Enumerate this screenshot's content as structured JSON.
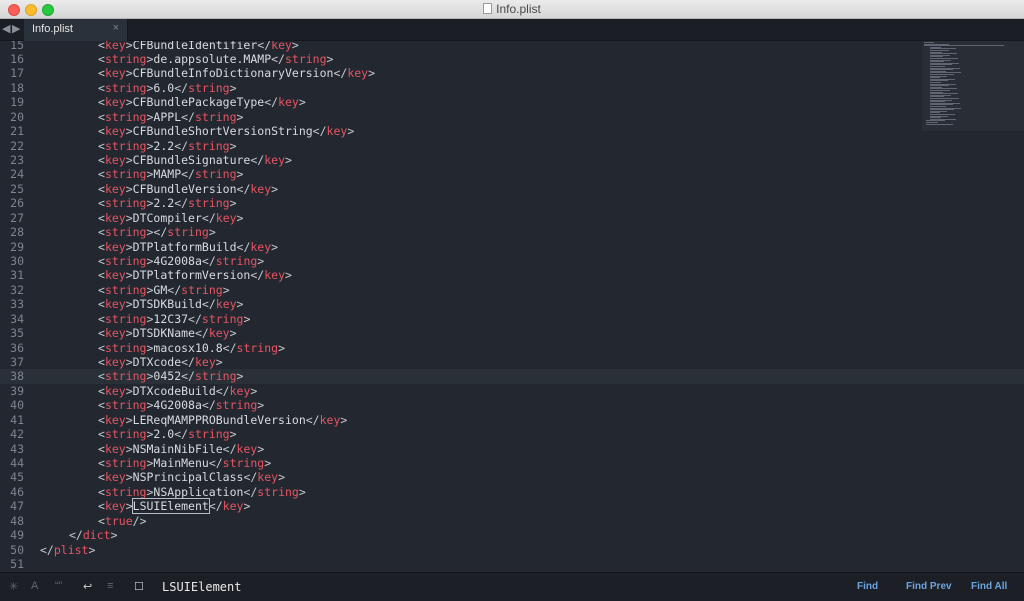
{
  "window": {
    "title": "Info.plist"
  },
  "tabs": [
    {
      "label": "Info.plist",
      "close": "×"
    }
  ],
  "nav": {
    "back": "◀",
    "forward": "▶"
  },
  "editor": {
    "current_line": 38,
    "lines": [
      {
        "n": "15",
        "indent": 2,
        "parts": [
          [
            "br",
            "<"
          ],
          [
            "tag",
            "key"
          ],
          [
            "br",
            ">"
          ],
          [
            "t",
            "CFBundleIdentifier"
          ],
          [
            "br",
            "</"
          ],
          [
            "tag",
            "key"
          ],
          [
            "br",
            ">"
          ]
        ]
      },
      {
        "n": "16",
        "indent": 2,
        "parts": [
          [
            "br",
            "<"
          ],
          [
            "tag",
            "string"
          ],
          [
            "br",
            ">"
          ],
          [
            "t",
            "de.appsolute.MAMP"
          ],
          [
            "br",
            "</"
          ],
          [
            "tag",
            "string"
          ],
          [
            "br",
            ">"
          ]
        ]
      },
      {
        "n": "17",
        "indent": 2,
        "parts": [
          [
            "br",
            "<"
          ],
          [
            "tag",
            "key"
          ],
          [
            "br",
            ">"
          ],
          [
            "t",
            "CFBundleInfoDictionaryVersion"
          ],
          [
            "br",
            "</"
          ],
          [
            "tag",
            "key"
          ],
          [
            "br",
            ">"
          ]
        ]
      },
      {
        "n": "18",
        "indent": 2,
        "parts": [
          [
            "br",
            "<"
          ],
          [
            "tag",
            "string"
          ],
          [
            "br",
            ">"
          ],
          [
            "t",
            "6.0"
          ],
          [
            "br",
            "</"
          ],
          [
            "tag",
            "string"
          ],
          [
            "br",
            ">"
          ]
        ]
      },
      {
        "n": "19",
        "indent": 2,
        "parts": [
          [
            "br",
            "<"
          ],
          [
            "tag",
            "key"
          ],
          [
            "br",
            ">"
          ],
          [
            "t",
            "CFBundlePackageType"
          ],
          [
            "br",
            "</"
          ],
          [
            "tag",
            "key"
          ],
          [
            "br",
            ">"
          ]
        ]
      },
      {
        "n": "20",
        "indent": 2,
        "parts": [
          [
            "br",
            "<"
          ],
          [
            "tag",
            "string"
          ],
          [
            "br",
            ">"
          ],
          [
            "t",
            "APPL"
          ],
          [
            "br",
            "</"
          ],
          [
            "tag",
            "string"
          ],
          [
            "br",
            ">"
          ]
        ]
      },
      {
        "n": "21",
        "indent": 2,
        "parts": [
          [
            "br",
            "<"
          ],
          [
            "tag",
            "key"
          ],
          [
            "br",
            ">"
          ],
          [
            "t",
            "CFBundleShortVersionString"
          ],
          [
            "br",
            "</"
          ],
          [
            "tag",
            "key"
          ],
          [
            "br",
            ">"
          ]
        ]
      },
      {
        "n": "22",
        "indent": 2,
        "parts": [
          [
            "br",
            "<"
          ],
          [
            "tag",
            "string"
          ],
          [
            "br",
            ">"
          ],
          [
            "t",
            "2.2"
          ],
          [
            "br",
            "</"
          ],
          [
            "tag",
            "string"
          ],
          [
            "br",
            ">"
          ]
        ]
      },
      {
        "n": "23",
        "indent": 2,
        "parts": [
          [
            "br",
            "<"
          ],
          [
            "tag",
            "key"
          ],
          [
            "br",
            ">"
          ],
          [
            "t",
            "CFBundleSignature"
          ],
          [
            "br",
            "</"
          ],
          [
            "tag",
            "key"
          ],
          [
            "br",
            ">"
          ]
        ]
      },
      {
        "n": "24",
        "indent": 2,
        "parts": [
          [
            "br",
            "<"
          ],
          [
            "tag",
            "string"
          ],
          [
            "br",
            ">"
          ],
          [
            "t",
            "MAMP"
          ],
          [
            "br",
            "</"
          ],
          [
            "tag",
            "string"
          ],
          [
            "br",
            ">"
          ]
        ]
      },
      {
        "n": "25",
        "indent": 2,
        "parts": [
          [
            "br",
            "<"
          ],
          [
            "tag",
            "key"
          ],
          [
            "br",
            ">"
          ],
          [
            "t",
            "CFBundleVersion"
          ],
          [
            "br",
            "</"
          ],
          [
            "tag",
            "key"
          ],
          [
            "br",
            ">"
          ]
        ]
      },
      {
        "n": "26",
        "indent": 2,
        "parts": [
          [
            "br",
            "<"
          ],
          [
            "tag",
            "string"
          ],
          [
            "br",
            ">"
          ],
          [
            "t",
            "2.2"
          ],
          [
            "br",
            "</"
          ],
          [
            "tag",
            "string"
          ],
          [
            "br",
            ">"
          ]
        ]
      },
      {
        "n": "27",
        "indent": 2,
        "parts": [
          [
            "br",
            "<"
          ],
          [
            "tag",
            "key"
          ],
          [
            "br",
            ">"
          ],
          [
            "t",
            "DTCompiler"
          ],
          [
            "br",
            "</"
          ],
          [
            "tag",
            "key"
          ],
          [
            "br",
            ">"
          ]
        ]
      },
      {
        "n": "28",
        "indent": 2,
        "parts": [
          [
            "br",
            "<"
          ],
          [
            "tag",
            "string"
          ],
          [
            "br",
            "></"
          ],
          [
            "tag",
            "string"
          ],
          [
            "br",
            ">"
          ]
        ]
      },
      {
        "n": "29",
        "indent": 2,
        "parts": [
          [
            "br",
            "<"
          ],
          [
            "tag",
            "key"
          ],
          [
            "br",
            ">"
          ],
          [
            "t",
            "DTPlatformBuild"
          ],
          [
            "br",
            "</"
          ],
          [
            "tag",
            "key"
          ],
          [
            "br",
            ">"
          ]
        ]
      },
      {
        "n": "30",
        "indent": 2,
        "parts": [
          [
            "br",
            "<"
          ],
          [
            "tag",
            "string"
          ],
          [
            "br",
            ">"
          ],
          [
            "t",
            "4G2008a"
          ],
          [
            "br",
            "</"
          ],
          [
            "tag",
            "string"
          ],
          [
            "br",
            ">"
          ]
        ]
      },
      {
        "n": "31",
        "indent": 2,
        "parts": [
          [
            "br",
            "<"
          ],
          [
            "tag",
            "key"
          ],
          [
            "br",
            ">"
          ],
          [
            "t",
            "DTPlatformVersion"
          ],
          [
            "br",
            "</"
          ],
          [
            "tag",
            "key"
          ],
          [
            "br",
            ">"
          ]
        ]
      },
      {
        "n": "32",
        "indent": 2,
        "parts": [
          [
            "br",
            "<"
          ],
          [
            "tag",
            "string"
          ],
          [
            "br",
            ">"
          ],
          [
            "t",
            "GM"
          ],
          [
            "br",
            "</"
          ],
          [
            "tag",
            "string"
          ],
          [
            "br",
            ">"
          ]
        ]
      },
      {
        "n": "33",
        "indent": 2,
        "parts": [
          [
            "br",
            "<"
          ],
          [
            "tag",
            "key"
          ],
          [
            "br",
            ">"
          ],
          [
            "t",
            "DTSDKBuild"
          ],
          [
            "br",
            "</"
          ],
          [
            "tag",
            "key"
          ],
          [
            "br",
            ">"
          ]
        ]
      },
      {
        "n": "34",
        "indent": 2,
        "parts": [
          [
            "br",
            "<"
          ],
          [
            "tag",
            "string"
          ],
          [
            "br",
            ">"
          ],
          [
            "t",
            "12C37"
          ],
          [
            "br",
            "</"
          ],
          [
            "tag",
            "string"
          ],
          [
            "br",
            ">"
          ]
        ]
      },
      {
        "n": "35",
        "indent": 2,
        "parts": [
          [
            "br",
            "<"
          ],
          [
            "tag",
            "key"
          ],
          [
            "br",
            ">"
          ],
          [
            "t",
            "DTSDKName"
          ],
          [
            "br",
            "</"
          ],
          [
            "tag",
            "key"
          ],
          [
            "br",
            ">"
          ]
        ]
      },
      {
        "n": "36",
        "indent": 2,
        "parts": [
          [
            "br",
            "<"
          ],
          [
            "tag",
            "string"
          ],
          [
            "br",
            ">"
          ],
          [
            "t",
            "macosx10.8"
          ],
          [
            "br",
            "</"
          ],
          [
            "tag",
            "string"
          ],
          [
            "br",
            ">"
          ]
        ]
      },
      {
        "n": "37",
        "indent": 2,
        "parts": [
          [
            "br",
            "<"
          ],
          [
            "tag",
            "key"
          ],
          [
            "br",
            ">"
          ],
          [
            "t",
            "DTXcode"
          ],
          [
            "br",
            "</"
          ],
          [
            "tag",
            "key"
          ],
          [
            "br",
            ">"
          ]
        ]
      },
      {
        "n": "38",
        "indent": 2,
        "parts": [
          [
            "br",
            "<"
          ],
          [
            "tag",
            "string"
          ],
          [
            "br",
            ">"
          ],
          [
            "t",
            "0452"
          ],
          [
            "br",
            "</"
          ],
          [
            "tag",
            "string"
          ],
          [
            "br",
            ">"
          ]
        ]
      },
      {
        "n": "39",
        "indent": 2,
        "parts": [
          [
            "br",
            "<"
          ],
          [
            "tag",
            "key"
          ],
          [
            "br",
            ">"
          ],
          [
            "t",
            "DTXcodeBuild"
          ],
          [
            "br",
            "</"
          ],
          [
            "tag",
            "key"
          ],
          [
            "br",
            ">"
          ]
        ]
      },
      {
        "n": "40",
        "indent": 2,
        "parts": [
          [
            "br",
            "<"
          ],
          [
            "tag",
            "string"
          ],
          [
            "br",
            ">"
          ],
          [
            "t",
            "4G2008a"
          ],
          [
            "br",
            "</"
          ],
          [
            "tag",
            "string"
          ],
          [
            "br",
            ">"
          ]
        ]
      },
      {
        "n": "41",
        "indent": 2,
        "parts": [
          [
            "br",
            "<"
          ],
          [
            "tag",
            "key"
          ],
          [
            "br",
            ">"
          ],
          [
            "t",
            "LEReqMAMPPROBundleVersion"
          ],
          [
            "br",
            "</"
          ],
          [
            "tag",
            "key"
          ],
          [
            "br",
            ">"
          ]
        ]
      },
      {
        "n": "42",
        "indent": 2,
        "parts": [
          [
            "br",
            "<"
          ],
          [
            "tag",
            "string"
          ],
          [
            "br",
            ">"
          ],
          [
            "t",
            "2.0"
          ],
          [
            "br",
            "</"
          ],
          [
            "tag",
            "string"
          ],
          [
            "br",
            ">"
          ]
        ]
      },
      {
        "n": "43",
        "indent": 2,
        "parts": [
          [
            "br",
            "<"
          ],
          [
            "tag",
            "key"
          ],
          [
            "br",
            ">"
          ],
          [
            "t",
            "NSMainNibFile"
          ],
          [
            "br",
            "</"
          ],
          [
            "tag",
            "key"
          ],
          [
            "br",
            ">"
          ]
        ]
      },
      {
        "n": "44",
        "indent": 2,
        "parts": [
          [
            "br",
            "<"
          ],
          [
            "tag",
            "string"
          ],
          [
            "br",
            ">"
          ],
          [
            "t",
            "MainMenu"
          ],
          [
            "br",
            "</"
          ],
          [
            "tag",
            "string"
          ],
          [
            "br",
            ">"
          ]
        ]
      },
      {
        "n": "45",
        "indent": 2,
        "parts": [
          [
            "br",
            "<"
          ],
          [
            "tag",
            "key"
          ],
          [
            "br",
            ">"
          ],
          [
            "t",
            "NSPrincipalClass"
          ],
          [
            "br",
            "</"
          ],
          [
            "tag",
            "key"
          ],
          [
            "br",
            ">"
          ]
        ]
      },
      {
        "n": "46",
        "indent": 2,
        "parts": [
          [
            "br",
            "<"
          ],
          [
            "tag",
            "string"
          ],
          [
            "br",
            ">"
          ],
          [
            "t",
            "NSApplication"
          ],
          [
            "br",
            "</"
          ],
          [
            "tag",
            "string"
          ],
          [
            "br",
            ">"
          ]
        ]
      },
      {
        "n": "47",
        "indent": 2,
        "parts": [
          [
            "br",
            "<"
          ],
          [
            "tag",
            "key"
          ],
          [
            "br",
            ">"
          ],
          [
            "hl",
            "LSUIElement"
          ],
          [
            "br",
            "</"
          ],
          [
            "tag",
            "key"
          ],
          [
            "br",
            ">"
          ]
        ]
      },
      {
        "n": "48",
        "indent": 2,
        "parts": [
          [
            "br",
            "<"
          ],
          [
            "tag",
            "true"
          ],
          [
            "br",
            "/>"
          ]
        ]
      },
      {
        "n": "49",
        "indent": 1,
        "parts": [
          [
            "br",
            "</"
          ],
          [
            "tag",
            "dict"
          ],
          [
            "br",
            ">"
          ]
        ]
      },
      {
        "n": "50",
        "indent": 0,
        "parts": [
          [
            "br",
            "</"
          ],
          [
            "tag",
            "plist"
          ],
          [
            "br",
            ">"
          ]
        ]
      },
      {
        "n": "51",
        "indent": 0,
        "parts": []
      }
    ]
  },
  "find": {
    "query": "LSUIElement",
    "find_label": "Find",
    "find_prev_label": "Find Prev",
    "find_all_label": "Find All"
  },
  "colors": {
    "tag": "#e75462",
    "text": "#d7dadf",
    "background": "#232830",
    "accent": "#6ba4dd"
  }
}
